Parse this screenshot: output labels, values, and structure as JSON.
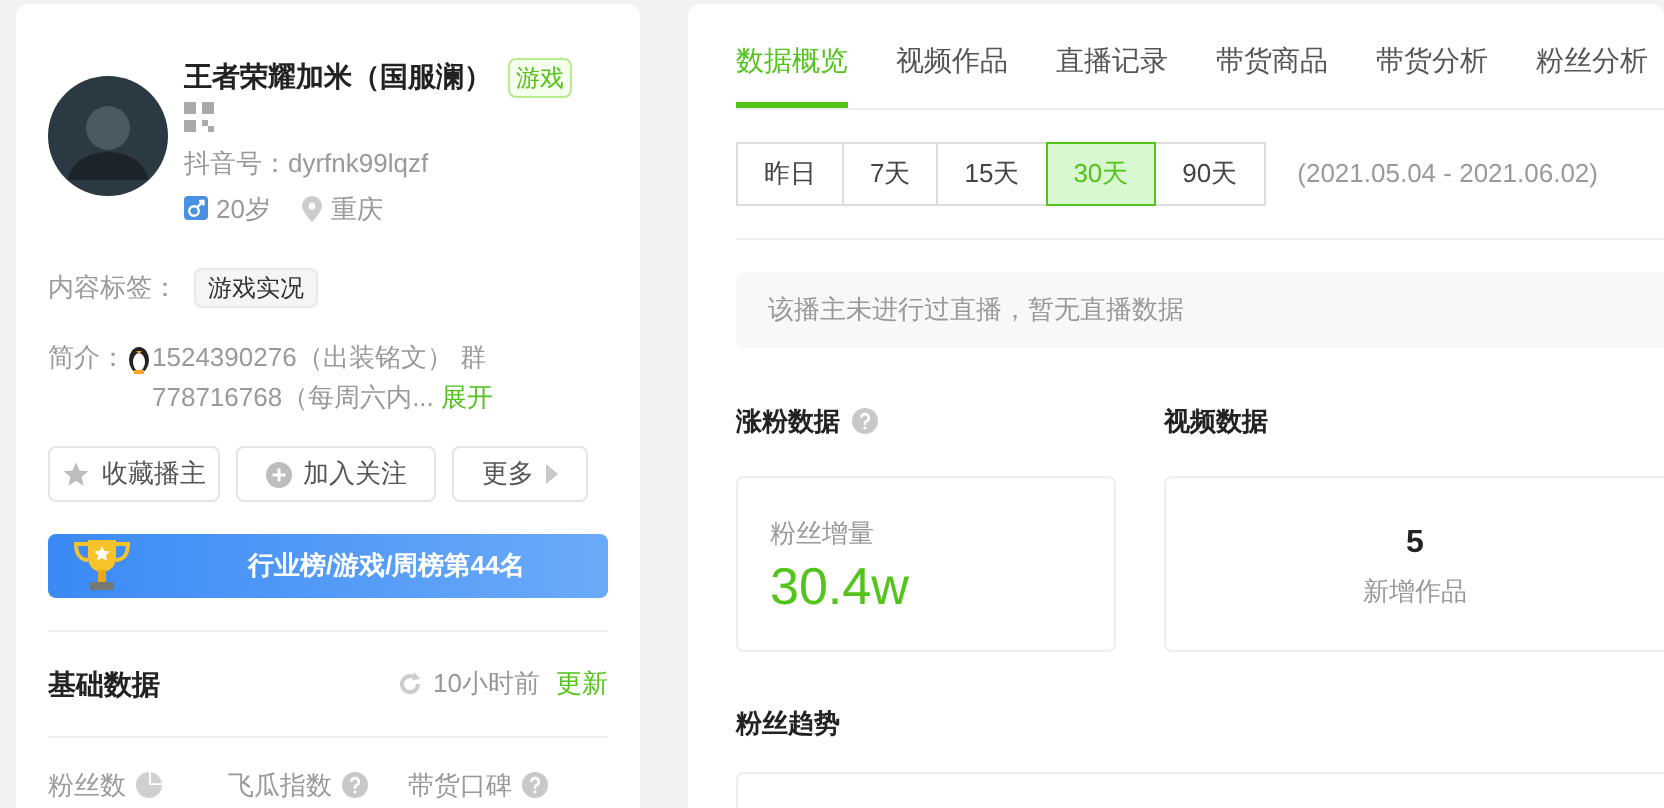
{
  "profile": {
    "name": "王者荣耀加米（国服澜）",
    "category": "游戏",
    "douyin_id": "抖音号：dyrfnk99lqzf",
    "age": "20岁",
    "location": "重庆",
    "tags_label": "内容标签：",
    "tags": [
      "游戏实况"
    ],
    "intro_label": "简介：",
    "intro": "1524390276（出装铭文） 群778716768（每周六内...",
    "expand": "展开"
  },
  "actions": [
    {
      "label": "收藏播主",
      "kind": "star"
    },
    {
      "label": "加入关注",
      "kind": "plus"
    },
    {
      "label": "更多",
      "kind": "more"
    }
  ],
  "rank_banner": "行业榜/游戏/周榜第44名",
  "basic": {
    "title": "基础数据",
    "updated": "10小时前",
    "update_link": "更新",
    "metrics": [
      {
        "label": "粉丝数",
        "kind": "pie"
      },
      {
        "label": "飞瓜指数",
        "kind": "help"
      },
      {
        "label": "带货口碑",
        "kind": "help"
      }
    ]
  },
  "tabs": [
    {
      "label": "数据概览",
      "selected": true
    },
    {
      "label": "视频作品",
      "selected": false
    },
    {
      "label": "直播记录",
      "selected": false
    },
    {
      "label": "带货商品",
      "selected": false
    },
    {
      "label": "带货分析",
      "selected": false
    },
    {
      "label": "粉丝分析",
      "selected": false
    }
  ],
  "ranges": [
    {
      "label": "昨日",
      "selected": false
    },
    {
      "label": "7天",
      "selected": false
    },
    {
      "label": "15天",
      "selected": false
    },
    {
      "label": "30天",
      "selected": true
    },
    {
      "label": "90天",
      "selected": false
    }
  ],
  "date_range": "(2021.05.04 - 2021.06.02)",
  "notice": "该播主未进行过直播，暂无直播数据",
  "fans_section": {
    "title": "涨粉数据",
    "label": "粉丝增量",
    "value": "30.4w"
  },
  "video_section": {
    "title": "视频数据",
    "value": "5",
    "label": "新增作品"
  },
  "trend_title": "粉丝趋势"
}
